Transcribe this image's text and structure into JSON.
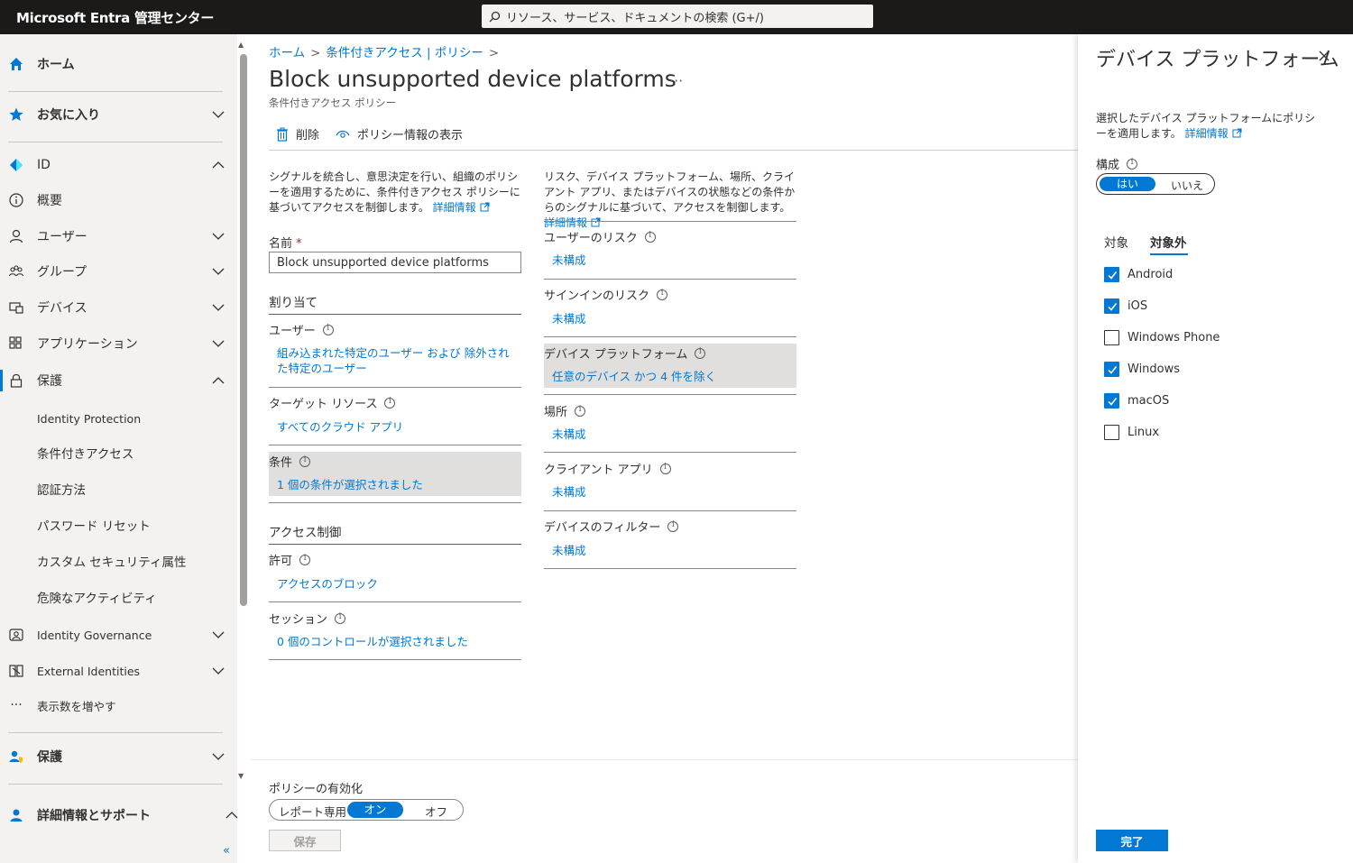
{
  "header": {
    "brand": "Microsoft Entra 管理センター",
    "search_placeholder": "リソース、サービス、ドキュメントの検索 (G+/)"
  },
  "sidebar": {
    "home": "ホーム",
    "favorites": "お気に入り",
    "id": "ID",
    "overview": "概要",
    "users": "ユーザー",
    "groups": "グループ",
    "devices": "デバイス",
    "applications": "アプリケーション",
    "protection": "保護",
    "identity_protection": "Identity Protection",
    "conditional_access": "条件付きアクセス",
    "auth_methods": "認証方法",
    "password_reset": "パスワード リセット",
    "custom_security": "カスタム セキュリティ属性",
    "risky_activities": "危険なアクティビティ",
    "identity_governance": "Identity Governance",
    "external_identities": "External Identities",
    "show_more": "表示数を増やす",
    "protection2": "保護",
    "learn_support": "詳細情報とサポート",
    "collapse": "«"
  },
  "breadcrumb": {
    "home": "ホーム",
    "policies": "条件付きアクセス | ポリシー"
  },
  "page": {
    "title": "Block unsupported device platforms",
    "subtitle": "条件付きアクセス ポリシー",
    "ellipsis": "···"
  },
  "commands": {
    "delete": "削除",
    "view_policy_info": "ポリシー情報の表示"
  },
  "left_col": {
    "description": "シグナルを統合し、意思決定を行い、組織のポリシーを適用するために、条件付きアクセス ポリシーに基づいてアクセスを制御します。",
    "learn_more": "詳細情報",
    "name_label": "名前",
    "required_mark": "*",
    "name_value": "Block unsupported device platforms",
    "assignments": "割り当て",
    "users_label": "ユーザー",
    "users_value": "組み込まれた特定のユーザー および 除外された特定のユーザー",
    "target_label": "ターゲット リソース",
    "target_value": "すべてのクラウド アプリ",
    "conditions_label": "条件",
    "conditions_value": "1 個の条件が選択されました",
    "access_controls": "アクセス制御",
    "grant_label": "許可",
    "grant_value": "アクセスのブロック",
    "session_label": "セッション",
    "session_value": "0 個のコントロールが選択されました"
  },
  "right_col": {
    "description": "リスク、デバイス プラットフォーム、場所、クライアント アプリ、またはデバイスの状態などの条件からのシグナルに基づいて、アクセスを制御します。",
    "learn_more": "詳細情報",
    "user_risk_label": "ユーザーのリスク",
    "user_risk_value": "未構成",
    "signin_risk_label": "サインインのリスク",
    "signin_risk_value": "未構成",
    "device_platform_label": "デバイス プラットフォーム",
    "device_platform_value": "任意のデバイス かつ 4 件を除く",
    "location_label": "場所",
    "location_value": "未構成",
    "client_apps_label": "クライアント アプリ",
    "client_apps_value": "未構成",
    "device_filter_label": "デバイスのフィルター",
    "device_filter_value": "未構成"
  },
  "bottom": {
    "enable_label": "ポリシーの有効化",
    "report_only": "レポート専用",
    "on": "オン",
    "off": "オフ",
    "save": "保存"
  },
  "panel": {
    "title": "デバイス プラットフォーム",
    "description": "選択したデバイス プラットフォームにポリシーを適用します。",
    "learn_more": "詳細情報",
    "configure_label": "構成",
    "yes": "はい",
    "no": "いいえ",
    "tab_include": "対象",
    "tab_exclude": "対象外",
    "platforms": [
      {
        "label": "Android",
        "checked": true
      },
      {
        "label": "iOS",
        "checked": true
      },
      {
        "label": "Windows Phone",
        "checked": false
      },
      {
        "label": "Windows",
        "checked": true
      },
      {
        "label": "macOS",
        "checked": true
      },
      {
        "label": "Linux",
        "checked": false
      }
    ],
    "done": "完了"
  },
  "colors": {
    "accent": "#0078d4",
    "topbar": "#1b1a19",
    "sidebar": "#f3f2f1",
    "highlight": "#e1dfdd"
  }
}
